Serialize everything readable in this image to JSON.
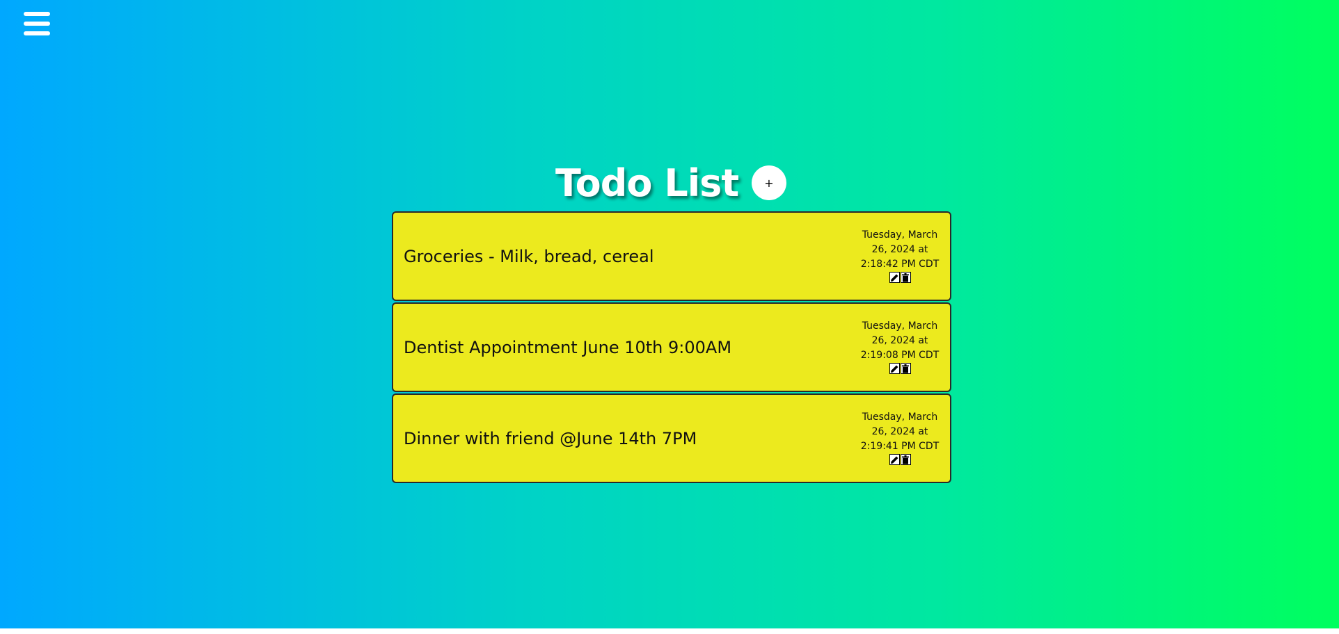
{
  "menu": {
    "icon": "hamburger-menu-icon"
  },
  "header": {
    "title": "Todo List",
    "add_label": "+"
  },
  "todos": [
    {
      "text": "Groceries - Milk, bread, cereal",
      "date_lines": [
        "Tuesday, March",
        "26, 2024 at",
        "2:18:42 PM CDT"
      ],
      "icons": [
        "edit-pencil-icon",
        "trash-icon"
      ]
    },
    {
      "text": "Dentist Appointment June 10th 9:00AM",
      "date_lines": [
        "Tuesday, March",
        "26, 2024 at",
        "2:19:08 PM CDT"
      ],
      "icons": [
        "edit-pencil-icon",
        "trash-icon"
      ]
    },
    {
      "text": "Dinner with friend @June 14th 7PM",
      "date_lines": [
        "Tuesday, March",
        "26, 2024 at",
        "2:19:41 PM CDT"
      ],
      "icons": [
        "edit-pencil-icon",
        "trash-icon"
      ]
    }
  ],
  "colors": {
    "gradient_start": "#00a8ff",
    "gradient_end": "#00ff5e",
    "todo_background": "#ecea1e",
    "todo_border": "#2a2a2a",
    "title_color": "#ffffff"
  }
}
